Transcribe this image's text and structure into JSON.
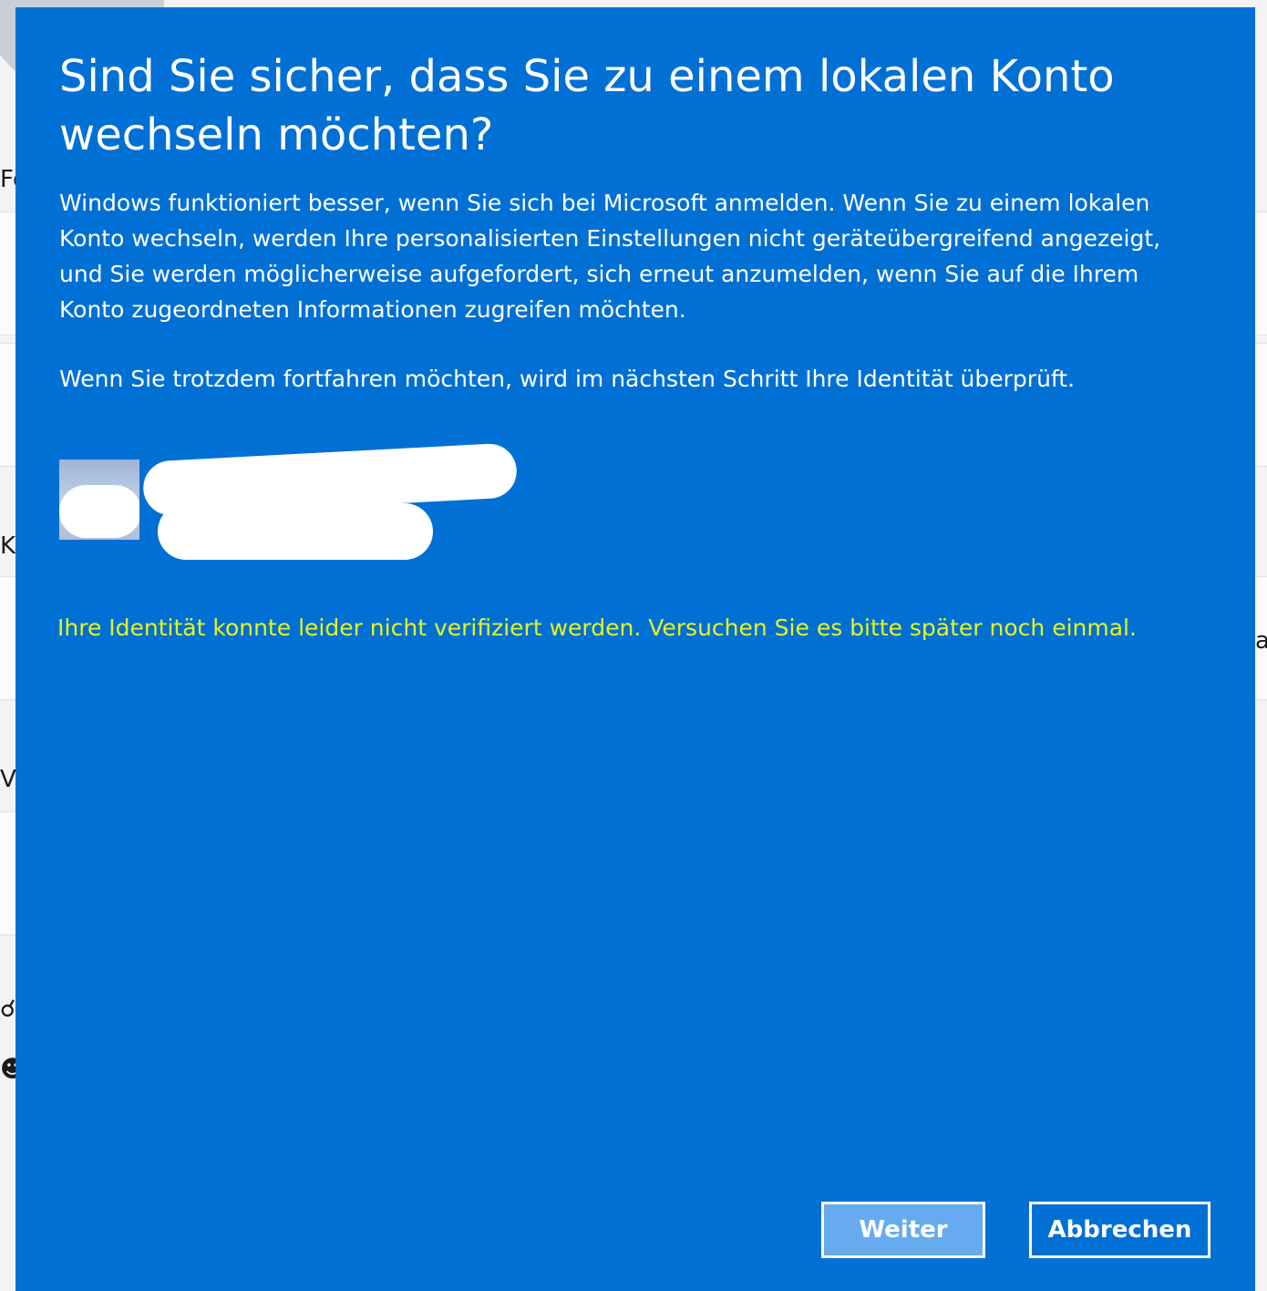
{
  "background": {
    "letters": [
      "Fo",
      "K",
      "V"
    ],
    "right_letters": [
      "a"
    ]
  },
  "dialog": {
    "title": "Sind Sie sicher, dass Sie zu einem lokalen Konto wechseln möchten?",
    "body_paragraph_1": "Windows funktioniert besser, wenn Sie sich bei Microsoft anmelden. Wenn Sie zu einem lokalen Konto wechseln, werden Ihre personalisierten Einstellungen nicht geräteübergreifend angezeigt, und Sie werden möglicherweise aufgefordert, sich erneut anzumelden, wenn Sie auf die Ihrem Konto zugeordneten Informationen zugreifen möchten.",
    "body_paragraph_2": "Wenn Sie trotzdem fortfahren möchten, wird im nächsten Schritt Ihre Identität überprüft.",
    "error_message": "Ihre Identität konnte leider nicht verifiziert werden. Versuchen Sie es bitte später noch einmal.",
    "buttons": {
      "continue_label": "Weiter",
      "cancel_label": "Abbrechen"
    }
  },
  "colors": {
    "dialog_background": "#0070d4",
    "error_text": "#e6f51c",
    "continue_button": "#66abf0"
  }
}
